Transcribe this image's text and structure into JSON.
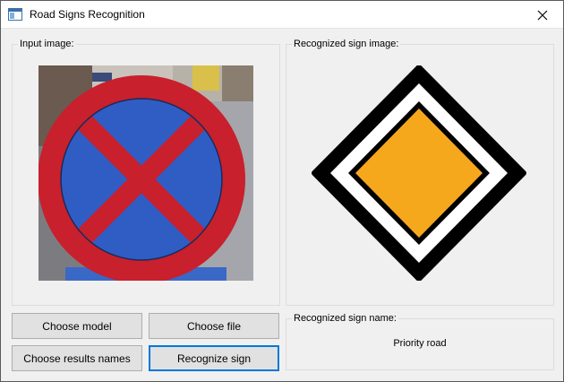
{
  "window": {
    "title": "Road Signs Recognition",
    "app_icon": "app-window-icon",
    "close_icon": "close-icon"
  },
  "input_group": {
    "title": "Input image:",
    "image": "no-stopping-sign-photo"
  },
  "recognized_group": {
    "title": "Recognized sign image:",
    "image": "priority-road-sign"
  },
  "buttons": {
    "choose_model": "Choose model",
    "choose_file": "Choose file",
    "choose_results_names": "Choose results names",
    "recognize_sign": "Recognize sign"
  },
  "name_group": {
    "title": "Recognized sign name:",
    "value": "Priority road"
  },
  "colors": {
    "accent": "#0078d7",
    "sign_red": "#c8202c",
    "sign_blue": "#2f5dc4",
    "priority_yellow": "#f6a81c"
  }
}
